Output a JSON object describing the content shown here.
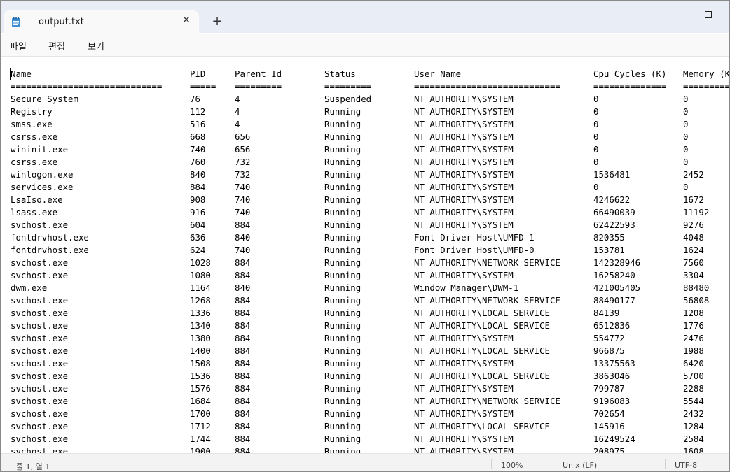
{
  "tab": {
    "title": "output.txt",
    "close_glyph": "✕",
    "new_tab_glyph": "+"
  },
  "menu": [
    "파일",
    "편집",
    "보기"
  ],
  "table": {
    "headers": [
      "Name",
      "PID",
      "Parent Id",
      "Status",
      "User Name",
      "Cpu Cycles (K)",
      "Memory (K"
    ],
    "underlines": [
      "=============================",
      "=====",
      "=========",
      "=========",
      "============================",
      "==============",
      "========="
    ],
    "rows": [
      [
        "Secure System",
        "76",
        "4",
        "Suspended",
        "NT AUTHORITY\\SYSTEM",
        "0",
        "0"
      ],
      [
        "Registry",
        "112",
        "4",
        "Running",
        "NT AUTHORITY\\SYSTEM",
        "0",
        "0"
      ],
      [
        "smss.exe",
        "516",
        "4",
        "Running",
        "NT AUTHORITY\\SYSTEM",
        "0",
        "0"
      ],
      [
        "csrss.exe",
        "668",
        "656",
        "Running",
        "NT AUTHORITY\\SYSTEM",
        "0",
        "0"
      ],
      [
        "wininit.exe",
        "740",
        "656",
        "Running",
        "NT AUTHORITY\\SYSTEM",
        "0",
        "0"
      ],
      [
        "csrss.exe",
        "760",
        "732",
        "Running",
        "NT AUTHORITY\\SYSTEM",
        "0",
        "0"
      ],
      [
        "winlogon.exe",
        "840",
        "732",
        "Running",
        "NT AUTHORITY\\SYSTEM",
        "1536481",
        "2452"
      ],
      [
        "services.exe",
        "884",
        "740",
        "Running",
        "NT AUTHORITY\\SYSTEM",
        "0",
        "0"
      ],
      [
        "LsaIso.exe",
        "908",
        "740",
        "Running",
        "NT AUTHORITY\\SYSTEM",
        "4246622",
        "1672"
      ],
      [
        "lsass.exe",
        "916",
        "740",
        "Running",
        "NT AUTHORITY\\SYSTEM",
        "66490039",
        "11192"
      ],
      [
        "svchost.exe",
        "604",
        "884",
        "Running",
        "NT AUTHORITY\\SYSTEM",
        "62422593",
        "9276"
      ],
      [
        "fontdrvhost.exe",
        "636",
        "840",
        "Running",
        "Font Driver Host\\UMFD-1",
        "820355",
        "4048"
      ],
      [
        "fontdrvhost.exe",
        "624",
        "740",
        "Running",
        "Font Driver Host\\UMFD-0",
        "153781",
        "1624"
      ],
      [
        "svchost.exe",
        "1028",
        "884",
        "Running",
        "NT AUTHORITY\\NETWORK SERVICE",
        "142328946",
        "7560"
      ],
      [
        "svchost.exe",
        "1080",
        "884",
        "Running",
        "NT AUTHORITY\\SYSTEM",
        "16258240",
        "3304"
      ],
      [
        "dwm.exe",
        "1164",
        "840",
        "Running",
        "Window Manager\\DWM-1",
        "421005405",
        "88480"
      ],
      [
        "svchost.exe",
        "1268",
        "884",
        "Running",
        "NT AUTHORITY\\NETWORK SERVICE",
        "88490177",
        "56808"
      ],
      [
        "svchost.exe",
        "1336",
        "884",
        "Running",
        "NT AUTHORITY\\LOCAL SERVICE",
        "84139",
        "1208"
      ],
      [
        "svchost.exe",
        "1340",
        "884",
        "Running",
        "NT AUTHORITY\\LOCAL SERVICE",
        "6512836",
        "1776"
      ],
      [
        "svchost.exe",
        "1380",
        "884",
        "Running",
        "NT AUTHORITY\\SYSTEM",
        "554772",
        "2476"
      ],
      [
        "svchost.exe",
        "1400",
        "884",
        "Running",
        "NT AUTHORITY\\LOCAL SERVICE",
        "966875",
        "1988"
      ],
      [
        "svchost.exe",
        "1508",
        "884",
        "Running",
        "NT AUTHORITY\\SYSTEM",
        "13375563",
        "6420"
      ],
      [
        "svchost.exe",
        "1536",
        "884",
        "Running",
        "NT AUTHORITY\\LOCAL SERVICE",
        "3863046",
        "5700"
      ],
      [
        "svchost.exe",
        "1576",
        "884",
        "Running",
        "NT AUTHORITY\\SYSTEM",
        "799787",
        "2288"
      ],
      [
        "svchost.exe",
        "1684",
        "884",
        "Running",
        "NT AUTHORITY\\NETWORK SERVICE",
        "9196083",
        "5544"
      ],
      [
        "svchost.exe",
        "1700",
        "884",
        "Running",
        "NT AUTHORITY\\SYSTEM",
        "702654",
        "2432"
      ],
      [
        "svchost.exe",
        "1712",
        "884",
        "Running",
        "NT AUTHORITY\\LOCAL SERVICE",
        "145916",
        "1284"
      ],
      [
        "svchost.exe",
        "1744",
        "884",
        "Running",
        "NT AUTHORITY\\SYSTEM",
        "16249524",
        "2584"
      ],
      [
        "svchost.exe",
        "1900",
        "884",
        "Running",
        "NT AUTHORITY\\SYSTEM",
        "208975",
        "1608"
      ]
    ]
  },
  "status": {
    "position": "줄 1, 열 1",
    "zoom": "100%",
    "line_ending": "Unix (LF)",
    "encoding": "UTF-8"
  },
  "colors": {
    "titlebar": "#e9eef6",
    "tab_active": "#f9f9f9",
    "editor_bg": "#ffffff",
    "accent": "#0067c0"
  }
}
